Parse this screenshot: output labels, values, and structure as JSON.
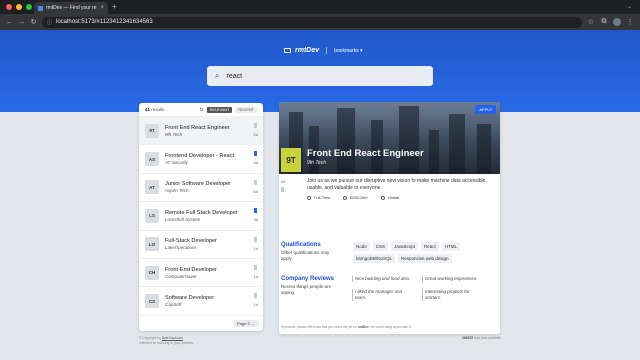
{
  "browser": {
    "tab_title": "rmtDev — Find your remote d",
    "url": "localhost:5173/#1123412341634563",
    "colors": {
      "close": "#ff5f57",
      "min": "#febc2e",
      "max": "#28c840"
    }
  },
  "header": {
    "logo": "rmtDev",
    "bookmarks_label": "bookmarks ▾"
  },
  "search": {
    "value": "react"
  },
  "sidebar": {
    "count": "41",
    "count_label": "results",
    "sort_relevant": "RELEVANT",
    "sort_recent": "RECENT",
    "items": [
      {
        "badge": "9T",
        "title": "Front End React Engineer",
        "company": "9th Tech",
        "age": "2d",
        "bookmarked": false,
        "selected": true
      },
      {
        "badge": "AS",
        "title": "Frontend Developer - React",
        "company": "AT Security",
        "age": "4d",
        "bookmarked": true,
        "selected": false
      },
      {
        "badge": "AT",
        "title": "Junior Software Developer",
        "company": "Aspen Tech",
        "age": "6d",
        "bookmarked": false,
        "selected": false
      },
      {
        "badge": "LS",
        "title": "Remote Full Stack Developer",
        "company": "Lockshelf System",
        "age": "3d",
        "bookmarked": true,
        "selected": false
      },
      {
        "badge": "LO",
        "title": "Full-Stack Developer",
        "company": "LakeOperations",
        "age": "1d",
        "bookmarked": false,
        "selected": false
      },
      {
        "badge": "CH",
        "title": "Front-End Developer",
        "company": "ComputerHaver",
        "age": "1d",
        "bookmarked": false,
        "selected": false
      },
      {
        "badge": "CS",
        "title": "Software Developer",
        "company": "CapSoft",
        "age": "1d",
        "bookmarked": false,
        "selected": false
      }
    ],
    "pager": "Page 2 →"
  },
  "detail": {
    "apply": "APPLY",
    "badge": "9T",
    "title": "Front End React Engineer",
    "company": "9th Tech",
    "age": "2d",
    "description": "Join us as we pursue our disruptive new vision to make machine data accessible, usable, and valuable to everyone.",
    "chips": [
      "Full-Time",
      "$105,000+",
      "Global"
    ],
    "qualifications_title": "Qualifications",
    "qualifications_desc": "Other qualifications may apply",
    "qualifications": [
      "Node",
      "CSS",
      "JavaScript",
      "React",
      "HTML",
      "MongoDB/NoSQL",
      "Responsive web design"
    ],
    "reviews_title": "Company Reviews",
    "reviews_desc": "Recent things people are saying",
    "reviews": [
      "Nice building and food also.",
      "Great working experience.",
      "I liked the manager and team.",
      "Interesting projects for starters."
    ],
    "footnote_pre": "If possible, please reference that you found the job on ",
    "footnote_brand": "rmtDev",
    "footnote_post": ", we would really appreciate it!"
  },
  "footer": {
    "copyright_pre": "© Copyright by ",
    "copyright_link": "ByteGrad.com",
    "copyright_line2": "Intended for learning or your portfolio.",
    "salary_count": "396925",
    "salary_text": " total jobs available"
  }
}
